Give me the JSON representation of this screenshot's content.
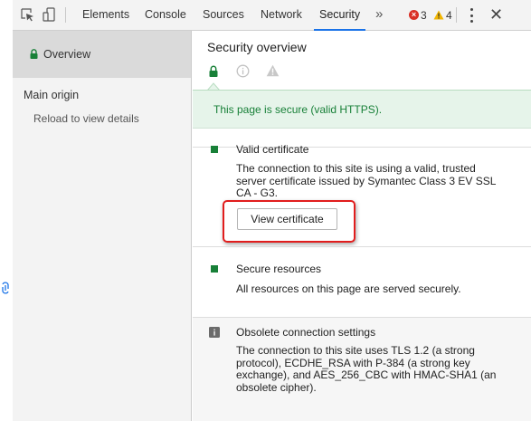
{
  "toolbar": {
    "tabs": [
      {
        "label": "Elements"
      },
      {
        "label": "Console"
      },
      {
        "label": "Sources"
      },
      {
        "label": "Network"
      },
      {
        "label": "Security",
        "active": true
      }
    ],
    "more_tabs_label": "»",
    "error_count": "3",
    "warning_count": "4",
    "close_label": "✕"
  },
  "sidebar": {
    "overview_label": "Overview",
    "main_origin_heading": "Main origin",
    "main_origin_sub": "Reload to view details"
  },
  "main": {
    "title": "Security overview",
    "banner_text": "This page is secure (valid HTTPS).",
    "sections": [
      {
        "title": "Valid certificate",
        "body": "The connection to this site is using a valid, trusted server certificate issued by Symantec Class 3 EV SSL CA - G3.",
        "button_label": "View certificate"
      },
      {
        "title": "Secure resources",
        "body": "All resources on this page are served securely."
      },
      {
        "title": "Obsolete connection settings",
        "body": "The connection to this site uses TLS 1.2 (a strong protocol), ECDHE_RSA with P-384 (a strong key exchange), and AES_256_CBC with HMAC-SHA1 (an obsolete cipher)."
      }
    ]
  },
  "colors": {
    "secure_green": "#188038",
    "banner_bg": "#e6f4ea",
    "highlight_red": "#e11d1d",
    "tab_accent": "#1a73e8",
    "error_red": "#d93025",
    "warning_yellow": "#f2b600"
  },
  "icons": [
    "inspect-element-icon",
    "device-toolbar-icon",
    "lock-icon",
    "info-icon",
    "warning-icon",
    "error-icon",
    "kebab-menu-icon",
    "close-icon",
    "secure-square-icon",
    "info-square-icon"
  ]
}
